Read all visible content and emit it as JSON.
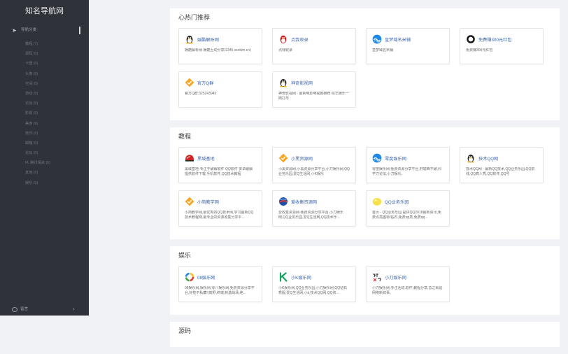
{
  "sidebar": {
    "logo": "知名导航网",
    "section_label": "导航分类",
    "items": [
      {
        "label": "教程 (7)"
      },
      {
        "label": "源码 (0)"
      },
      {
        "label": "卡盟 (0)"
      },
      {
        "label": "头像 (0)"
      },
      {
        "label": "空间 (0)"
      },
      {
        "label": "游戏 (0)"
      },
      {
        "label": "论坛 (0)"
      },
      {
        "label": "影视 (0)"
      },
      {
        "label": "美食 (0)"
      },
      {
        "label": "软件 (0)"
      },
      {
        "label": "邮箱 (0)"
      },
      {
        "label": "论坛 (0)"
      },
      {
        "label": "FL 腾讯相关 (0)"
      },
      {
        "label": "其他 (0)"
      },
      {
        "label": "娱乐 (3)"
      }
    ],
    "footer_label": "留言"
  },
  "sections": [
    {
      "title": "心热门推荐",
      "cards": [
        {
          "name": "娱酷解析网",
          "desc": "娱酷解析网-娱酷互动分享(2345.xzxtkm.cn)",
          "icon": "qq-penguin-icon"
        },
        {
          "name": "点我收录",
          "desc": "点我收录",
          "icon": "red-penguin-icon"
        },
        {
          "name": "皇梦域名米铺",
          "desc": "皇梦域名米铺",
          "icon": "wave-logo-icon"
        },
        {
          "name": "免费赚300元红包",
          "desc": "免费赚300元红包",
          "icon": "ring-logo-icon"
        },
        {
          "name": "官方Q群",
          "desc": "官方Q群:325243945",
          "icon": "check-badge-icon"
        },
        {
          "name": "神奇影视网",
          "desc": "神奇影视网 - 最新电影电视剧推荐 综艺娱乐一网打尽",
          "icon": "qq-penguin-icon"
        }
      ]
    },
    {
      "title": "教程",
      "cards": [
        {
          "name": "黑域基地",
          "desc": "黑域基地-专注于破解软件 QQ软件 安卓破解 提供软件下载,手机软件,QQ技术教程",
          "icon": "red-dome-icon"
        },
        {
          "name": "小黑资源网",
          "desc": "小黑资源网,小黑资源分享平台,小刀娱乐网,QQ业务乐园,爱Q生活网,小K娱乐",
          "icon": "check-badge-icon"
        },
        {
          "name": "零度娱乐网",
          "desc": "零度娱乐网,免费资源分享平台,轩辕西不破,科学刀论坛,小刀娱乐。",
          "icon": "wave-logo-icon"
        },
        {
          "name": "技术QQ网",
          "desc": "技术QQ网 - 最新QQ技术,QQ业务乐园,QQ前线,QQ真人秀,QQ软件,QQ号",
          "icon": "qq-penguin-icon"
        },
        {
          "name": "小简教学网",
          "desc": "小简教学网,最优秀的QQ技术网,学习最新QQ技术教程网,最专业的资源收集分享平...",
          "icon": "check-badge-icon"
        },
        {
          "name": "爱收集资源网",
          "desc": "爱收集资源网-免费资源分享平台,小刀娱乐网,QQ业务乐园,爱Q生活网,QQ技术乐...",
          "icon": "globe-icon"
        },
        {
          "name": "QQ业务乐园",
          "desc": "首页 - QQ业务乐园 提供QQ2018最新资讯,免费点亮图标/钻石,免费qq秀,免费qq...",
          "icon": "yellow-blob-icon"
        }
      ]
    },
    {
      "title": "娱乐",
      "cards": [
        {
          "name": "08娱乐网",
          "desc": "08娱乐网,娱乐网,零八娱乐网,免费资源分享平台,好技不私藏!(高野,终端,刺激战场,绝...",
          "icon": "rainbow-ring-icon"
        },
        {
          "name": "小K娱乐网",
          "desc": "小K娱乐网,QQ业务乐园,小刀娱乐网,QQ钻石秀服,爱Q生活网,小k,技术QQ网,QQ资...",
          "icon": "green-k-icon"
        },
        {
          "name": "小刀娱乐网",
          "desc": "小刀娱乐网,专注活动,软件,教程分享,总之就是网络新鲜事。",
          "icon": "knife-text-icon"
        }
      ]
    },
    {
      "title": "源码",
      "cards": []
    }
  ]
}
